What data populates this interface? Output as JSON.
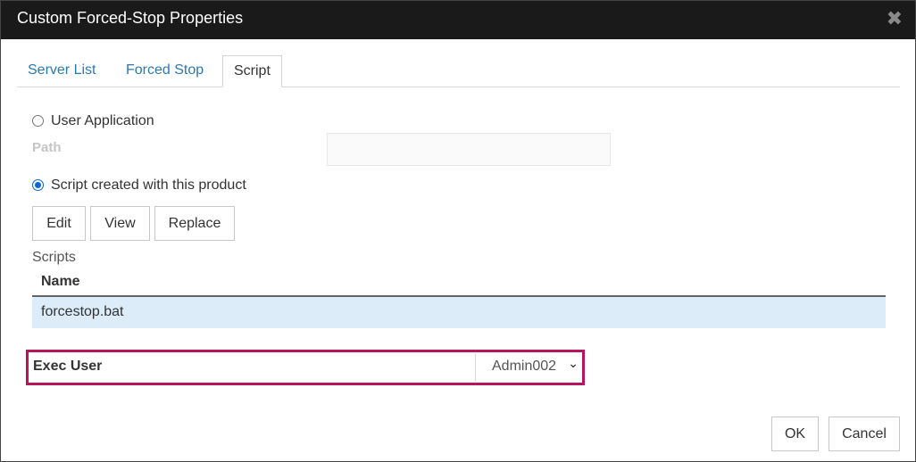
{
  "window": {
    "title": "Custom Forced-Stop Properties",
    "close_glyph": "✖"
  },
  "tabs": [
    {
      "label": "Server List",
      "active": false
    },
    {
      "label": "Forced Stop",
      "active": false
    },
    {
      "label": "Script",
      "active": true
    }
  ],
  "script_tab": {
    "user_application_label": "User Application",
    "user_application_selected": false,
    "path_label": "Path",
    "path_value": "",
    "script_created_label": "Script created with this product",
    "script_created_selected": true,
    "buttons": {
      "edit": "Edit",
      "view": "View",
      "replace": "Replace"
    },
    "scripts_label": "Scripts",
    "table": {
      "columns": [
        "Name"
      ],
      "rows": [
        {
          "name": "forcestop.bat",
          "selected": true
        }
      ]
    },
    "exec_user": {
      "label": "Exec User",
      "selected": "Admin002",
      "chevron": "⌄"
    }
  },
  "footer": {
    "ok": "OK",
    "cancel": "Cancel"
  },
  "colors": {
    "titlebar_bg": "#1a1a1a",
    "tab_link": "#2a7ab0",
    "row_selected_bg": "#dcecf9",
    "highlight_border": "#b8155c",
    "radio_checked": "#0a67d8"
  }
}
